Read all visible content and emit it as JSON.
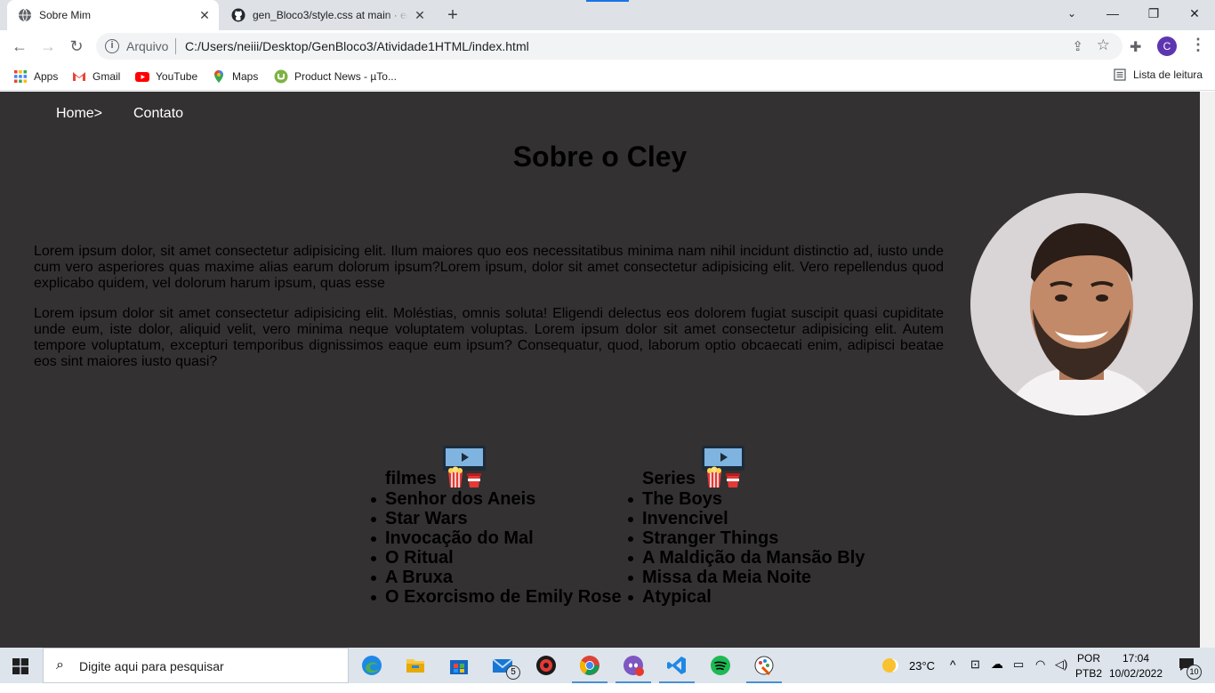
{
  "browser": {
    "tabs": [
      {
        "title": "Sobre Mim",
        "active": true
      },
      {
        "title": "gen_Bloco3/style.css at main · ee",
        "active": false
      }
    ],
    "new_tab_label": "+",
    "window_controls": {
      "minimize": "—",
      "restore": "❐",
      "close": "✕"
    },
    "address": {
      "scheme": "Arquivo",
      "url": "C:/Users/neiii/Desktop/GenBloco3/Atividade1HTML/index.html"
    },
    "profile_initial": "C",
    "bookmarks": [
      "Apps",
      "Gmail",
      "YouTube",
      "Maps",
      "Product News - µTo..."
    ],
    "reading_list": "Lista de leitura"
  },
  "page": {
    "nav": [
      "Home>",
      "Contato"
    ],
    "title": "Sobre o Cley",
    "paragraphs": [
      "Lorem ipsum dolor, sit amet consectetur adipisicing elit. Ilum maiores quo eos necessitatibus minima nam nihil incidunt distinctio ad, iusto unde cum vero asperiores quas maxime alias earum dolorum ipsum?Lorem ipsum, dolor sit amet consectetur adipisicing elit. Vero repellendus quod explicabo quidem, vel dolorum harum ipsum, quas esse",
      "Lorem ipsum dolor sit amet consectetur adipisicing elit. Moléstias, omnis soluta! Eligendi delectus eos dolorem fugiat suscipit quasi cupiditate unde eum, iste dolor, aliquid velit, vero minima neque voluptatem voluptas. Lorem ipsum dolor sit amet consectetur adipisicing elit. Autem tempore voluptatum, excepturi temporibus dignissimos eaque eum ipsum? Consequatur, quod, laborum optio obcaecati enim, adipisci beatae eos sint maiores iusto quasi?"
    ],
    "lists": [
      {
        "heading": "filmes",
        "items": [
          "Senhor dos Aneis",
          "Star Wars",
          "Invocação do Mal",
          "O Ritual",
          "A Bruxa",
          "O Exorcismo de Emily Rose"
        ]
      },
      {
        "heading": "Series",
        "items": [
          "The Boys",
          "Invencivel",
          "Stranger Things",
          "A Maldição da Mansão Bly",
          "Missa da Meia Noite",
          "Atypical"
        ]
      }
    ]
  },
  "taskbar": {
    "search_placeholder": "Digite aqui para pesquisar",
    "mail_badge": "5",
    "weather": "23°C",
    "language": "POR",
    "keyboard": "PTB2",
    "time": "17:04",
    "date": "10/02/2022",
    "notifications": "10"
  },
  "colors": {
    "page_bg": "#333132",
    "tab_bar": "#dee1e6",
    "taskbar": "#dde4ec"
  }
}
